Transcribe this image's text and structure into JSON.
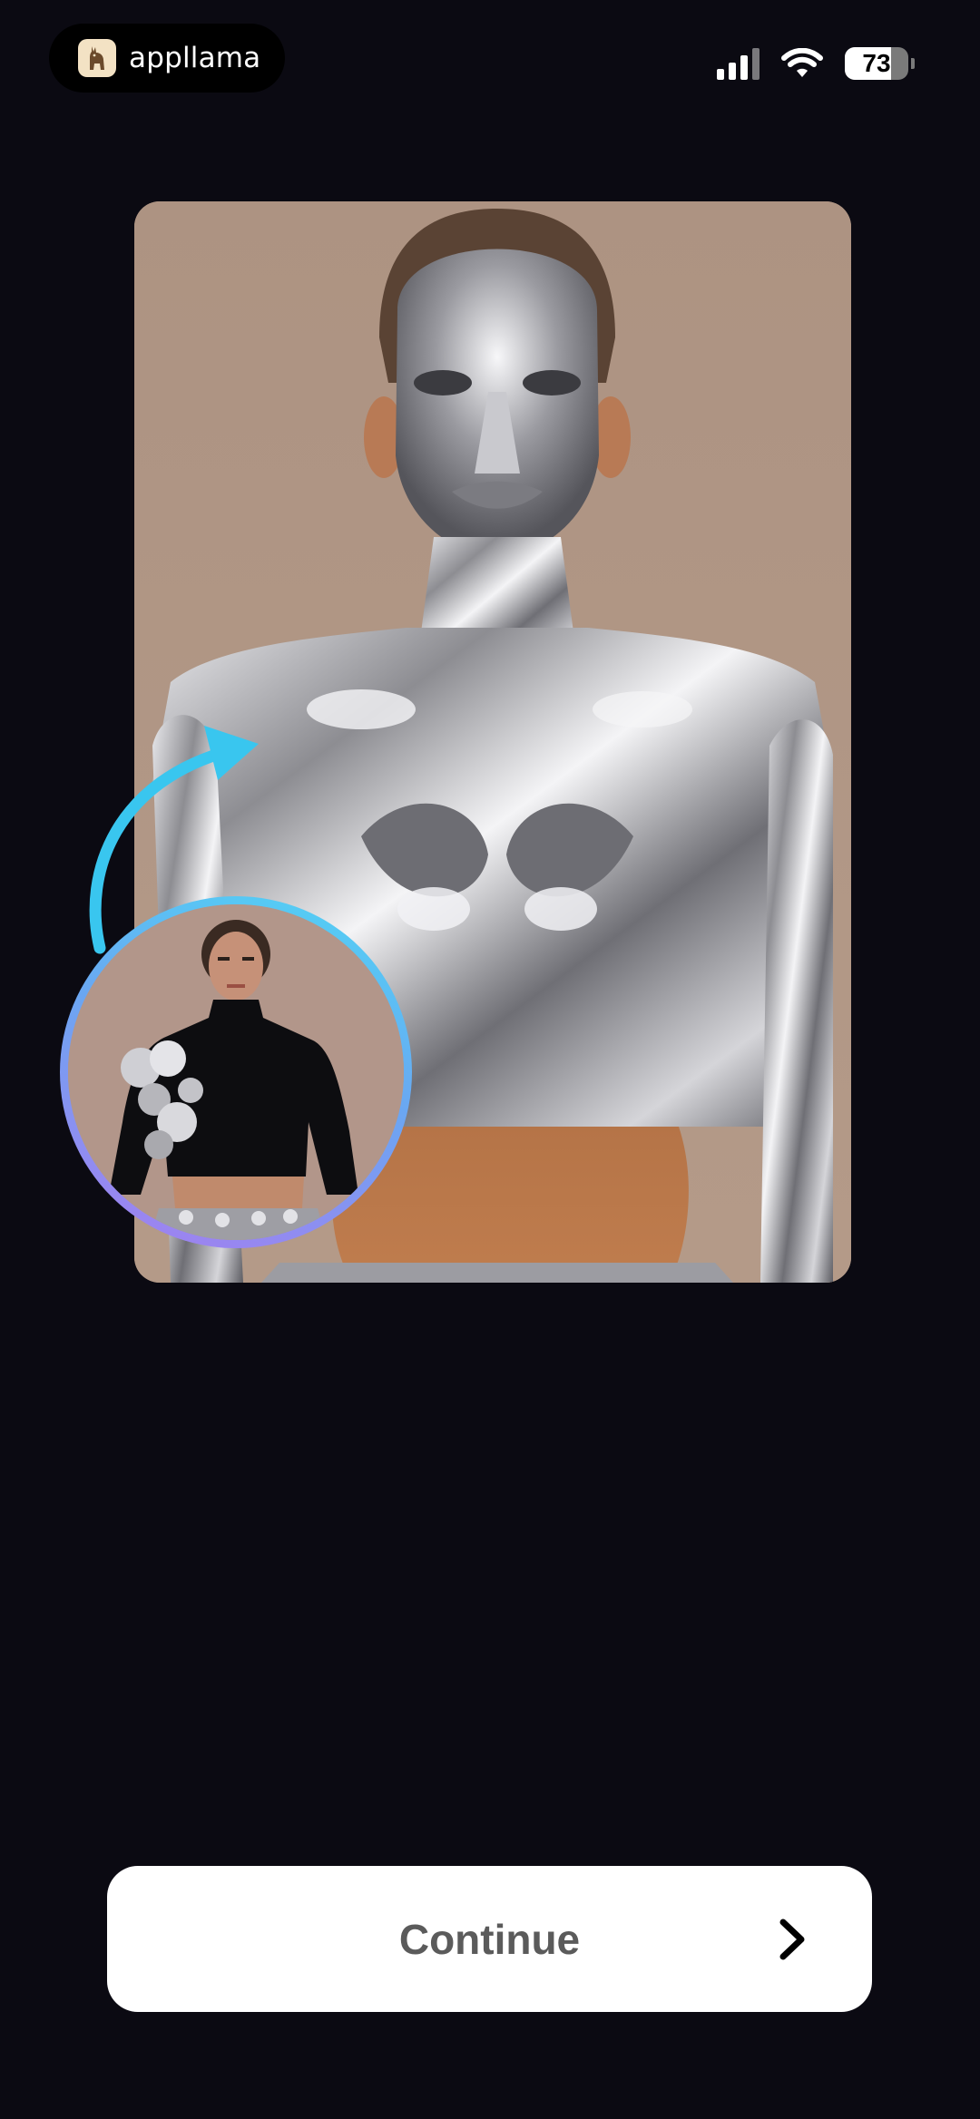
{
  "status_bar": {
    "app_name": "appllama",
    "battery_level": "73",
    "battery_fraction": 0.73,
    "icons": [
      "signal-icon",
      "wifi-icon",
      "battery-icon"
    ]
  },
  "hero": {
    "image": "chrome-metallic-figure",
    "thumbnail": "woman-in-black-crop-top-with-silver-bows",
    "arrow": "curved-arrow-icon"
  },
  "footer": {
    "continue_label": "Continue",
    "continue_icon": "chevron-right-icon"
  },
  "colors": {
    "background": "#0b0a12",
    "button": "#ffffff",
    "button_text": "#5b5b5b",
    "ring_start": "#4fd6f5",
    "ring_end": "#a77cf0"
  }
}
